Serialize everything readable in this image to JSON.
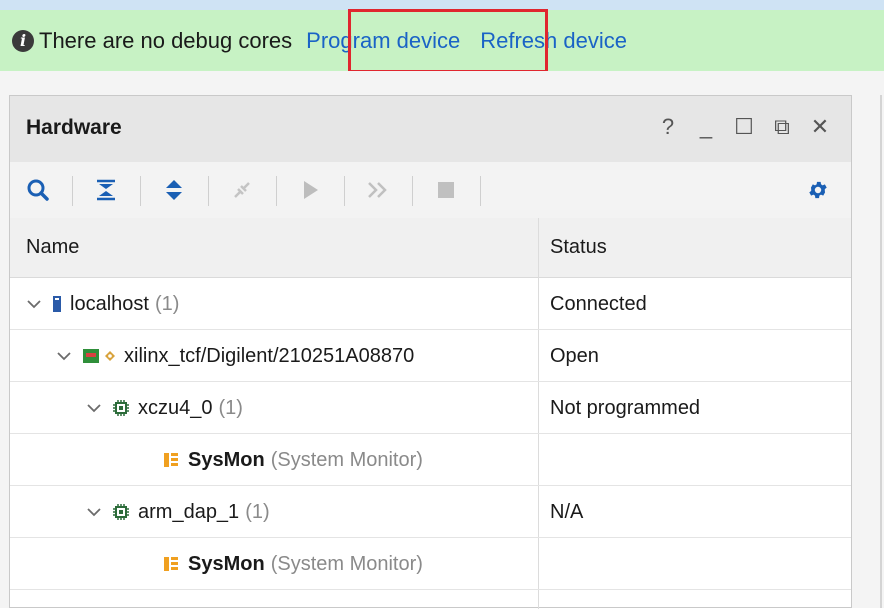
{
  "info_bar": {
    "message": "There are no debug cores",
    "program_link": "Program device",
    "refresh_link": "Refresh device"
  },
  "panel": {
    "title": "Hardware",
    "controls": {
      "help": "?",
      "minimize": "_",
      "maximize": "☐",
      "float": "⧉",
      "close": "✕"
    }
  },
  "toolbar": {
    "icons": [
      "search-icon",
      "collapse-all-icon",
      "expand-all-icon",
      "auto-connect-icon",
      "run-icon",
      "fast-forward-icon",
      "stop-icon",
      "gear-icon"
    ]
  },
  "table": {
    "columns": {
      "name": "Name",
      "status": "Status"
    },
    "rows": [
      {
        "label": "localhost",
        "suffix": "(1)",
        "status": "Connected"
      },
      {
        "label": "xilinx_tcf/Digilent/210251A08870",
        "suffix": "",
        "status": "Open"
      },
      {
        "label": "xczu4_0",
        "suffix": "(1)",
        "status": "Not programmed"
      },
      {
        "label": "SysMon",
        "suffix": "(System Monitor)",
        "status": ""
      },
      {
        "label": "arm_dap_1",
        "suffix": "(1)",
        "status": "N/A"
      },
      {
        "label": "SysMon",
        "suffix": "(System Monitor)",
        "status": ""
      }
    ]
  },
  "colors": {
    "info_bar_bg": "#c7f2c4",
    "link": "#1a63c6",
    "highlight": "#e0262e",
    "accent_blue": "#1a5fb4"
  }
}
